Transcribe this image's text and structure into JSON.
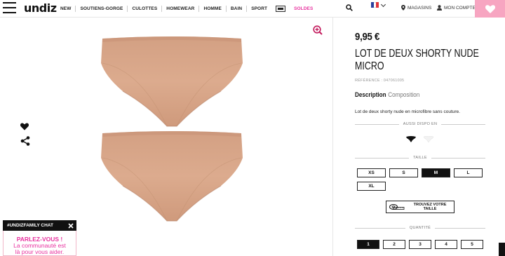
{
  "header": {
    "logo": "undiz",
    "nav": [
      "NEW",
      "SOUTIENS-GORGE",
      "CULOTTES",
      "HOMEWEAR",
      "HOMME",
      "BAIN",
      "SPORT"
    ],
    "soldes": "SOLDES",
    "stores_label": "MAGASINS",
    "account_label": "MON COMPTE"
  },
  "product": {
    "price": "9,95 €",
    "title_line1": "LOT DE DEUX SHORTY NUDE",
    "title_line2": "MICRO",
    "reference": "RÉFÉRENCE : 047061005",
    "tab_description": "Description",
    "tab_composition": "Composition",
    "description": "Lot de deux shorty nude en microfibre sans couture.",
    "colors_label": "AUSSI DISPO EN",
    "size_label": "TAILLE",
    "sizes": [
      {
        "label": "XS",
        "selected": false
      },
      {
        "label": "S",
        "selected": false
      },
      {
        "label": "M",
        "selected": true
      },
      {
        "label": "L",
        "selected": false
      },
      {
        "label": "XL",
        "selected": false
      }
    ],
    "size_guide_line1": "TROUVEZ VOTRE",
    "size_guide_line2": "TAILLE",
    "qty_label": "QUANTITÉ",
    "quantities": [
      {
        "label": "1",
        "selected": true
      },
      {
        "label": "2",
        "selected": false
      },
      {
        "label": "3",
        "selected": false
      },
      {
        "label": "4",
        "selected": false
      },
      {
        "label": "5",
        "selected": false
      }
    ]
  },
  "chat": {
    "title": "#UNDIZFAMILY CHAT",
    "line1": "PARLEZ-VOUS !",
    "line2": "La communauté est",
    "line3": "là pour vous aider."
  },
  "colors": {
    "accent_pink": "#e8329f",
    "cart_bg": "#f7a5c1",
    "product_nude": "#d9a98b"
  },
  "icons": [
    "menu-icon",
    "search-icon",
    "france-flag-icon",
    "chevron-down-icon",
    "location-pin-icon",
    "user-icon",
    "heart-icon",
    "share-icon",
    "zoom-icon",
    "close-icon",
    "measuring-tape-icon"
  ]
}
